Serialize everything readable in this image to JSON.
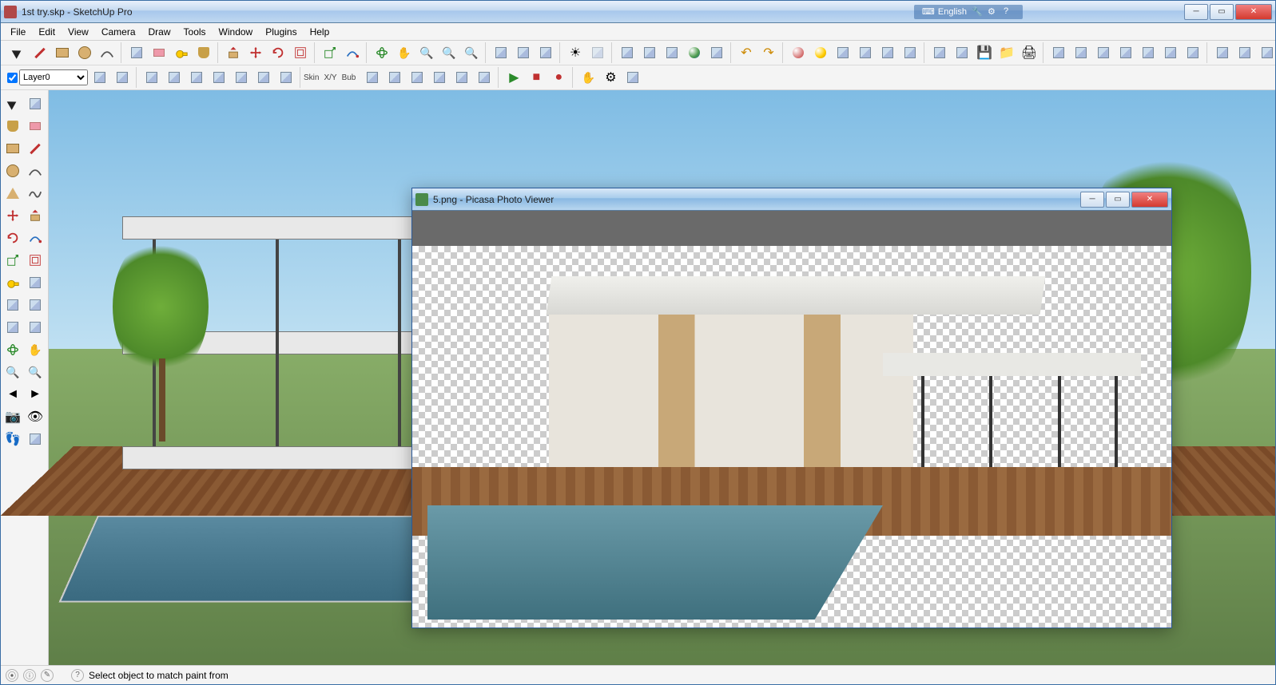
{
  "main": {
    "title": "1st try.skp - SketchUp Pro",
    "language_widget": {
      "label": "English"
    },
    "menus": [
      "File",
      "Edit",
      "View",
      "Camera",
      "Draw",
      "Tools",
      "Window",
      "Plugins",
      "Help"
    ],
    "toolbar_row1_groups": [
      [
        "select-tool",
        "line-tool",
        "rectangle-tool",
        "circle-tool",
        "arc-tool"
      ],
      [
        "make-component",
        "eraser-tool",
        "tape-measure",
        "paint-bucket"
      ],
      [
        "push-pull",
        "move-tool",
        "rotate-tool",
        "offset-tool"
      ],
      [
        "scale-tool",
        "follow-me"
      ],
      [
        "orbit",
        "pan",
        "zoom",
        "zoom-extents",
        "zoom-window"
      ],
      [
        "outliner",
        "section",
        "section-display"
      ],
      [
        "shadows",
        "xray"
      ],
      [
        "add-scene",
        "prev-scene",
        "next-scene",
        "google-earth",
        "upload"
      ],
      [
        "undo",
        "redo"
      ],
      [
        "model-info",
        "yellow-marker",
        "render",
        "lights",
        "materials",
        "3d-warehouse"
      ],
      [
        "export",
        "import",
        "save",
        "folder",
        "print"
      ],
      [
        "iso",
        "top",
        "front",
        "right",
        "back",
        "left",
        "perspective"
      ],
      [
        "style1",
        "style2",
        "style3",
        "style4",
        "style5",
        "style6",
        "style7"
      ]
    ],
    "layer": {
      "visible_checked": true,
      "current": "Layer0"
    },
    "row2_labels": [
      "Skin",
      "X/Y",
      "Bub"
    ],
    "toolbar_row2_groups": [
      [
        "layer-visible",
        "layer-select",
        "layer-manager",
        "layer-color"
      ],
      [
        "sandbox-contours",
        "sandbox-scratch",
        "sandbox-smoove",
        "sandbox-stamp",
        "sandbox-drape",
        "sandbox-detail",
        "sandbox-flip"
      ],
      [
        "solid-union",
        "solid-subtract",
        "solid-trim",
        "solid-intersect",
        "solid-split",
        "solid-outer"
      ],
      [
        "play",
        "stop",
        "rec"
      ],
      [
        "dyn-interact",
        "dyn-options",
        "dyn-attrs"
      ]
    ],
    "left_palette_rows": [
      [
        "select-tool",
        "make-component"
      ],
      [
        "paint-bucket",
        "eraser-tool"
      ],
      [
        "rectangle-tool",
        "line-tool"
      ],
      [
        "circle-tool",
        "arc-tool"
      ],
      [
        "polygon-tool",
        "freehand"
      ],
      [
        "move-tool",
        "push-pull"
      ],
      [
        "rotate-tool",
        "follow-me"
      ],
      [
        "scale-tool",
        "offset-tool"
      ],
      [
        "tape-measure",
        "dimension"
      ],
      [
        "protractor",
        "text-tool"
      ],
      [
        "axes-tool",
        "3d-text"
      ],
      [
        "orbit",
        "pan"
      ],
      [
        "zoom",
        "zoom-window"
      ],
      [
        "previous-view",
        "next-view"
      ],
      [
        "position-camera",
        "look-around"
      ],
      [
        "walk",
        "section-plane"
      ]
    ],
    "statusbar": {
      "hint": "Select object to match paint from"
    }
  },
  "picasa": {
    "title": "5.png - Picasa Photo Viewer"
  },
  "icon_map": {
    "select-tool": "arrow",
    "line-tool": "pencil",
    "rectangle-tool": "rect",
    "circle-tool": "circle",
    "arc-tool": "arc",
    "polygon-tool": "tri",
    "freehand": "scribble",
    "make-component": "cube",
    "eraser-tool": "eraser",
    "tape-measure": "tape",
    "paint-bucket": "paint",
    "push-pull": "pushpull",
    "move-tool": "move",
    "rotate-tool": "rotate",
    "offset-tool": "offset",
    "scale-tool": "scale",
    "follow-me": "follow",
    "orbit": "orbit",
    "pan": "hand",
    "zoom": "zoom",
    "zoom-extents": "zoomext",
    "zoom-window": "zoomwin",
    "previous-view": "prev",
    "next-view": "next",
    "outliner": "outliner",
    "section": "section",
    "section-display": "sectiond",
    "shadows": "sun",
    "xray": "xray",
    "add-scene": "plus",
    "prev-scene": "sprev",
    "next-scene": "snext",
    "google-earth": "earth",
    "upload": "upload",
    "undo": "undo",
    "redo": "redo",
    "model-info": "minfo",
    "yellow-marker": "gold",
    "render": "render",
    "lights": "light",
    "materials": "mat",
    "3d-warehouse": "wh",
    "export": "export",
    "import": "import",
    "save": "save",
    "folder": "folder",
    "print": "print",
    "iso": "cube",
    "top": "cube",
    "front": "cube",
    "right": "cube",
    "back": "cube",
    "left": "cube",
    "perspective": "cube",
    "style1": "cube",
    "style2": "cube",
    "style3": "cube",
    "style4": "cube",
    "style5": "cube",
    "style6": "cube",
    "style7": "cube",
    "layer-visible": "check",
    "layer-manager": "layers",
    "layer-color": "swatch",
    "sandbox-contours": "sb",
    "sandbox-scratch": "sb",
    "sandbox-smoove": "sb",
    "sandbox-stamp": "sb",
    "sandbox-drape": "sb",
    "sandbox-detail": "sb",
    "sandbox-flip": "sb",
    "solid-union": "solid",
    "solid-subtract": "solid",
    "solid-trim": "solid",
    "solid-intersect": "solid",
    "solid-split": "solid",
    "solid-outer": "solid",
    "play": "play",
    "stop": "stop",
    "rec": "rec",
    "dyn-interact": "hand",
    "dyn-options": "gear",
    "dyn-attrs": "attrs",
    "dimension": "dim",
    "protractor": "prot",
    "text-tool": "text",
    "axes-tool": "axes",
    "3d-text": "3dt",
    "position-camera": "cam",
    "look-around": "eye",
    "walk": "walk",
    "section-plane": "secp"
  }
}
